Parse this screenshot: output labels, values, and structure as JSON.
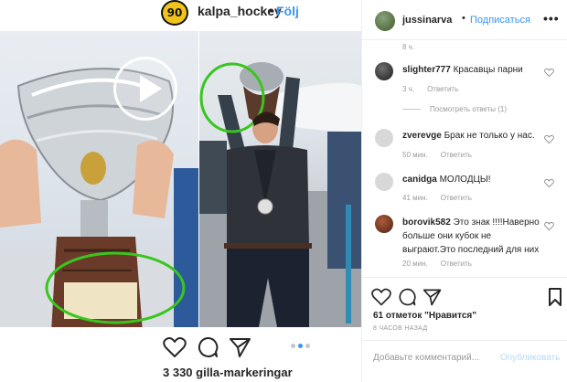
{
  "post": {
    "account_badge": "90",
    "username": "kalpa_hockey",
    "separator": "•",
    "follow_label": "Följ",
    "likes_text": "3 330 gilla-markeringar",
    "carousel_total": 3,
    "carousel_active": 2
  },
  "panel": {
    "username": "jussinarva",
    "separator": "•",
    "subscribe_label": "Подписаться",
    "more_label": "•••",
    "top_time": "8 ч.",
    "comments": [
      {
        "user": "slighter777",
        "text": "Красавцы парни",
        "time": "3 ч.",
        "reply": "Ответить"
      },
      {
        "user": "zverevge",
        "text": "Брак не только у нас.",
        "time": "50 мин.",
        "reply": "Ответить"
      },
      {
        "user": "canidga",
        "text": "МОЛОДЦЫ!",
        "time": "41 мин.",
        "reply": "Ответить"
      },
      {
        "user": "borovik582",
        "text": "Это знак !!!!Наверно больше они кубок не выграют.Это последний для них",
        "time": "20 мин.",
        "reply": "Ответить"
      }
    ],
    "view_replies": "Посмотреть ответы (1)",
    "likes_text": "61 отметок \"Нравится\"",
    "time_ago": "8 ЧАСОВ НАЗАД",
    "add_comment_placeholder": "Добавьте комментарий...",
    "publish_label": "Опубликовать"
  },
  "colors": {
    "link_blue": "#3897f0",
    "publish_disabled": "#b3dbff",
    "annotation_green": "#39c61e",
    "badge_yellow": "#f2c318"
  },
  "icons": [
    "heart-icon",
    "comment-icon",
    "share-icon",
    "bookmark-icon",
    "play-icon"
  ]
}
